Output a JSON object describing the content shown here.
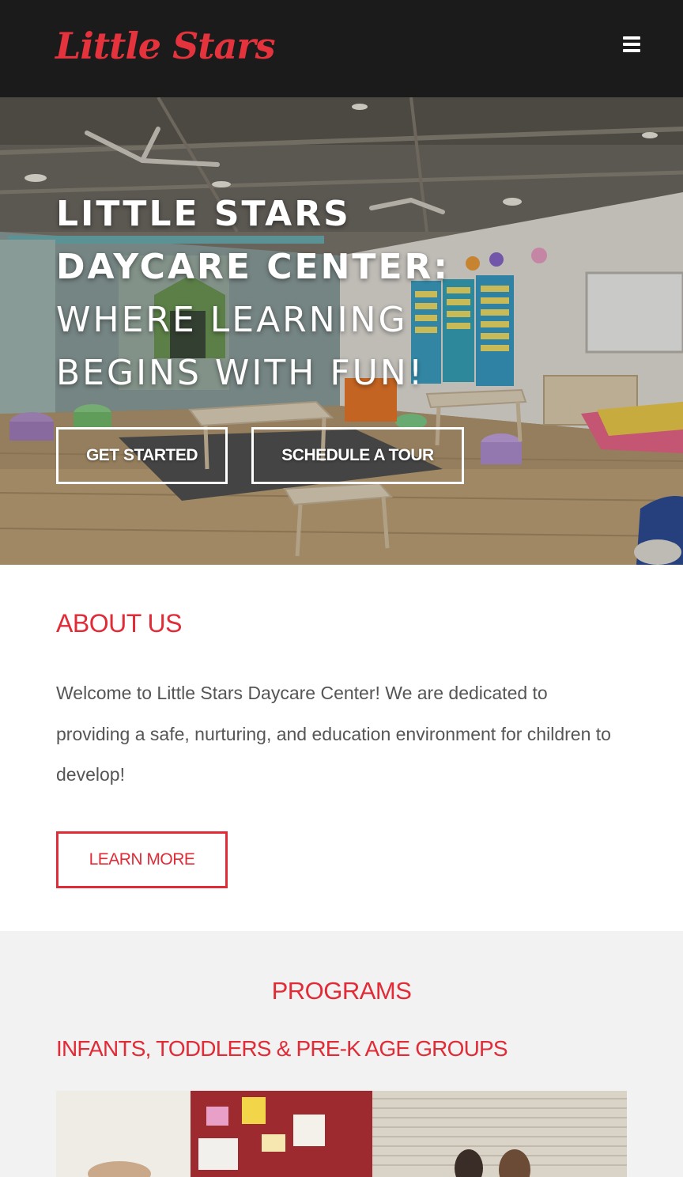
{
  "header": {
    "logo_text": "Little Stars",
    "menu_icon": "hamburger-menu-icon"
  },
  "hero": {
    "title_line1": "LITTLE STARS",
    "title_line2": "DAYCARE CENTER:",
    "title_line3": "WHERE LEARNING",
    "title_line4": "BEGINS WITH FUN!",
    "primary_button": "GET STARTED",
    "secondary_button": "SCHEDULE A TOUR"
  },
  "about": {
    "title": "ABOUT US",
    "text": "Welcome to Little Stars Daycare Center! We are dedicated to providing a safe, nurturing, and education environment for children to develop!",
    "button": "LEARN MORE"
  },
  "programs": {
    "title": "PROGRAMS",
    "subtitle": "INFANTS, TODDLERS & PRE-K AGE GROUPS"
  },
  "colors": {
    "accent": "#e12b37",
    "header_bg": "#1b1b1b",
    "section_bg": "#f2f2f2",
    "body_text": "#555555"
  }
}
